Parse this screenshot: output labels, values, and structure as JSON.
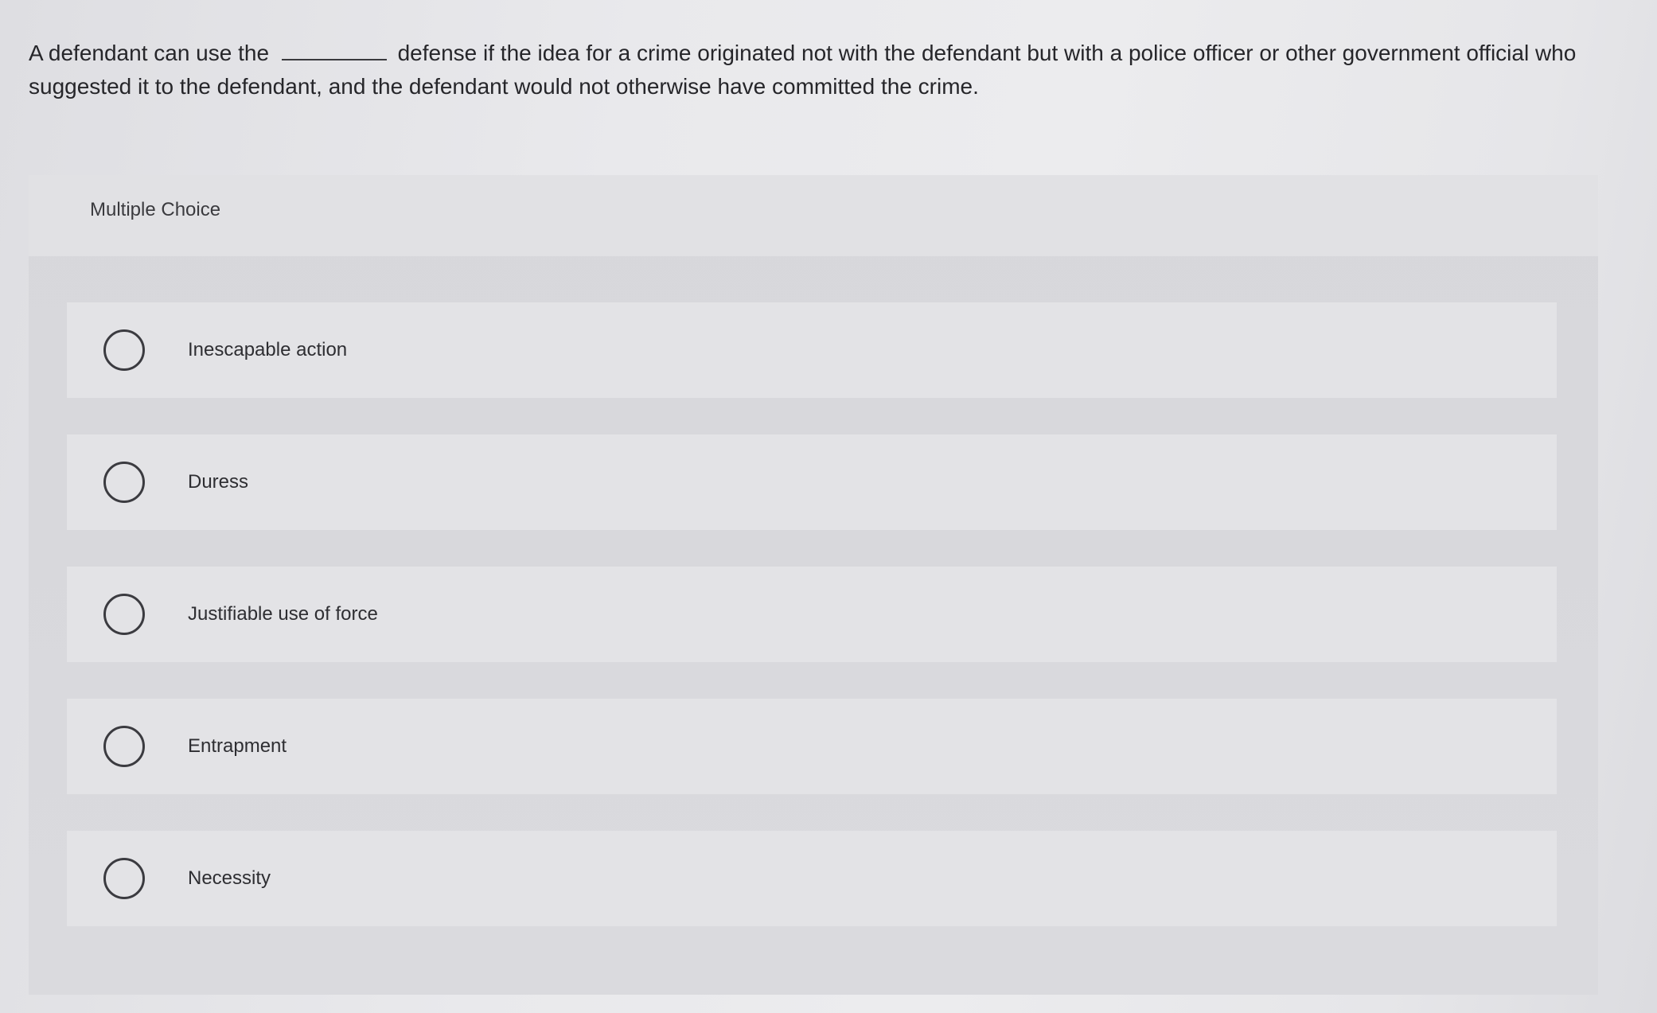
{
  "question": {
    "text_before_blank": "A defendant can use the",
    "text_after_blank": "defense if the idea for a crime originated not with the defendant but with a police officer or other government official who suggested it to the defendant, and the defendant would not otherwise have committed the crime."
  },
  "panel": {
    "title": "Multiple Choice"
  },
  "options": [
    {
      "label": "Inescapable action",
      "selected": false
    },
    {
      "label": "Duress",
      "selected": false
    },
    {
      "label": "Justifiable use of force",
      "selected": false
    },
    {
      "label": "Entrapment",
      "selected": false
    },
    {
      "label": "Necessity",
      "selected": false
    }
  ]
}
